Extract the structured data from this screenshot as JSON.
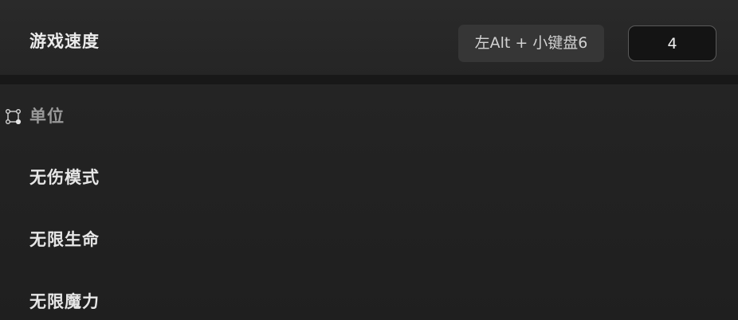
{
  "speed_setting": {
    "label": "游戏速度",
    "hotkey": "左Alt + 小键盘6",
    "value": "4"
  },
  "units_section": {
    "icon": "unit-selection-icon",
    "title": "单位",
    "options": [
      {
        "label": "无伤模式"
      },
      {
        "label": "无限生命"
      },
      {
        "label": "无限魔力"
      }
    ]
  }
}
